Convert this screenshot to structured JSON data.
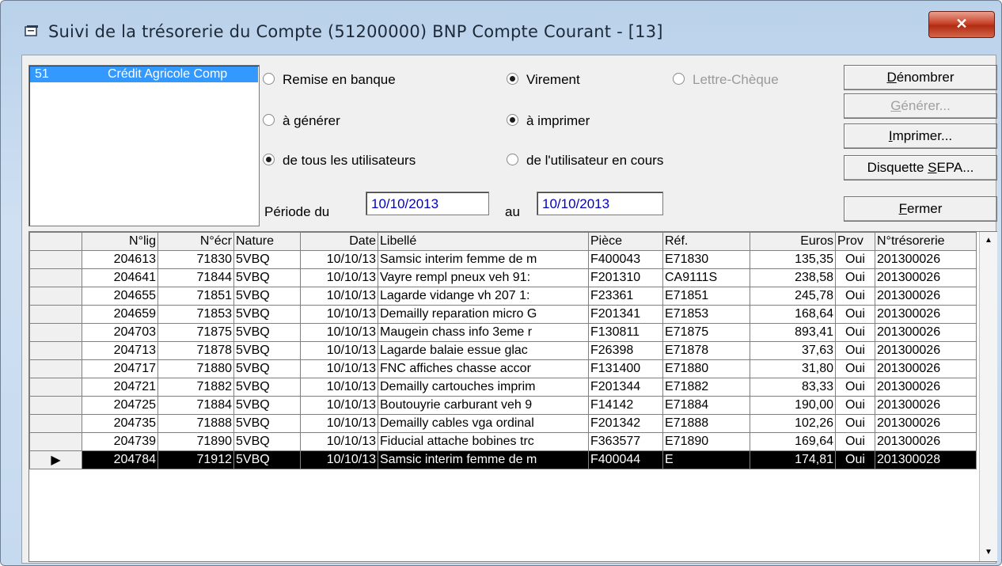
{
  "window": {
    "title": "Suivi de la trésorerie du Compte (51200000) BNP Compte Courant - [13]",
    "close_label": "✕"
  },
  "account_list": {
    "selected": {
      "code": "51",
      "name": "Crédit Agricole Comp"
    }
  },
  "options": {
    "remise": "Remise en banque",
    "virement": "Virement",
    "lettre": "Lettre-Chèque",
    "a_generer": "à générer",
    "a_imprimer": "à imprimer",
    "tous": "de tous les utilisateurs",
    "courant": "de l'utilisateur en cours"
  },
  "period": {
    "label_from": "Période du",
    "from": "10/10/2013",
    "label_to": "au",
    "to": "10/10/2013"
  },
  "buttons": {
    "denombrer": {
      "first": "D",
      "rest": "énombrer"
    },
    "generer": {
      "first": "G",
      "rest": "énérer..."
    },
    "imprimer": {
      "first": "I",
      "rest": "mprimer..."
    },
    "disquette": {
      "pre": "Disquette ",
      "u": "S",
      "post": "EPA..."
    },
    "fermer": {
      "first": "F",
      "rest": "ermer"
    }
  },
  "table": {
    "columns": [
      "N°lig",
      "N°écr",
      "Nature",
      "Date",
      "Libellé",
      "Pièce",
      "Réf.",
      "Euros",
      "Prov",
      "N°trésorerie"
    ],
    "rows": [
      [
        "204613",
        "71830",
        "5VBQ",
        "10/10/13",
        "Samsic interim femme de m",
        "F400043",
        "E71830",
        "135,35",
        "Oui",
        "201300026"
      ],
      [
        "204641",
        "71844",
        "5VBQ",
        "10/10/13",
        "Vayre  rempl pneux veh 91:",
        "F201310",
        "CA9111S",
        "238,58",
        "Oui",
        "201300026"
      ],
      [
        "204655",
        "71851",
        "5VBQ",
        "10/10/13",
        "Lagarde vidange vh 207 1:",
        "F23361",
        "E71851",
        "245,78",
        "Oui",
        "201300026"
      ],
      [
        "204659",
        "71853",
        "5VBQ",
        "10/10/13",
        "Demailly reparation micro G",
        "F201341",
        "E71853",
        "168,64",
        "Oui",
        "201300026"
      ],
      [
        "204703",
        "71875",
        "5VBQ",
        "10/10/13",
        "Maugein chass info 3eme r",
        "F130811",
        "E71875",
        "893,41",
        "Oui",
        "201300026"
      ],
      [
        "204713",
        "71878",
        "5VBQ",
        "10/10/13",
        "Lagarde  balaie essue glac",
        "F26398",
        "E71878",
        "37,63",
        "Oui",
        "201300026"
      ],
      [
        "204717",
        "71880",
        "5VBQ",
        "10/10/13",
        "FNC affiches chasse accor",
        "F131400",
        "E71880",
        "31,80",
        "Oui",
        "201300026"
      ],
      [
        "204721",
        "71882",
        "5VBQ",
        "10/10/13",
        "Demailly cartouches imprim",
        "F201344",
        "E71882",
        "83,33",
        "Oui",
        "201300026"
      ],
      [
        "204725",
        "71884",
        "5VBQ",
        "10/10/13",
        "Boutouyrie carburant veh 9",
        "F14142",
        "E71884",
        "190,00",
        "Oui",
        "201300026"
      ],
      [
        "204735",
        "71888",
        "5VBQ",
        "10/10/13",
        "Demailly cables vga ordinal",
        "F201342",
        "E71888",
        "102,26",
        "Oui",
        "201300026"
      ],
      [
        "204739",
        "71890",
        "5VBQ",
        "10/10/13",
        "Fiducial attache bobines trc",
        "F363577",
        "E71890",
        "169,64",
        "Oui",
        "201300026"
      ],
      [
        "204784",
        "71912",
        "5VBQ",
        "10/10/13",
        "Samsic interim femme de m",
        "F400044",
        "E",
        "174,81",
        "Oui",
        "201300028"
      ]
    ],
    "selected_row_index": 11,
    "row_indicator": "▶"
  },
  "colors": {
    "selection": "#3399ff",
    "field_text": "#0000c0",
    "close": "#c8442c"
  }
}
